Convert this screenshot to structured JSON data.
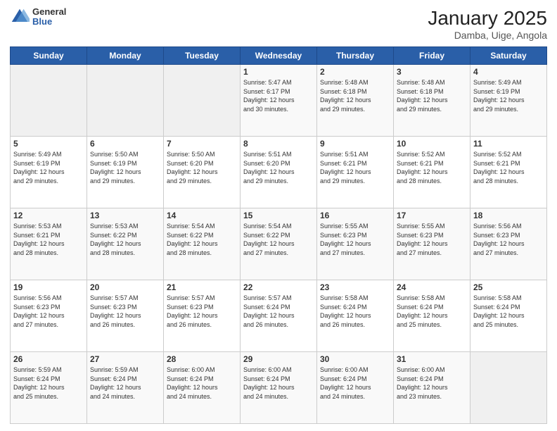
{
  "header": {
    "logo_general": "General",
    "logo_blue": "Blue",
    "title": "January 2025",
    "subtitle": "Damba, Uige, Angola"
  },
  "days_of_week": [
    "Sunday",
    "Monday",
    "Tuesday",
    "Wednesday",
    "Thursday",
    "Friday",
    "Saturday"
  ],
  "weeks": [
    [
      {
        "day": "",
        "info": ""
      },
      {
        "day": "",
        "info": ""
      },
      {
        "day": "",
        "info": ""
      },
      {
        "day": "1",
        "info": "Sunrise: 5:47 AM\nSunset: 6:17 PM\nDaylight: 12 hours\nand 30 minutes."
      },
      {
        "day": "2",
        "info": "Sunrise: 5:48 AM\nSunset: 6:18 PM\nDaylight: 12 hours\nand 29 minutes."
      },
      {
        "day": "3",
        "info": "Sunrise: 5:48 AM\nSunset: 6:18 PM\nDaylight: 12 hours\nand 29 minutes."
      },
      {
        "day": "4",
        "info": "Sunrise: 5:49 AM\nSunset: 6:19 PM\nDaylight: 12 hours\nand 29 minutes."
      }
    ],
    [
      {
        "day": "5",
        "info": "Sunrise: 5:49 AM\nSunset: 6:19 PM\nDaylight: 12 hours\nand 29 minutes."
      },
      {
        "day": "6",
        "info": "Sunrise: 5:50 AM\nSunset: 6:19 PM\nDaylight: 12 hours\nand 29 minutes."
      },
      {
        "day": "7",
        "info": "Sunrise: 5:50 AM\nSunset: 6:20 PM\nDaylight: 12 hours\nand 29 minutes."
      },
      {
        "day": "8",
        "info": "Sunrise: 5:51 AM\nSunset: 6:20 PM\nDaylight: 12 hours\nand 29 minutes."
      },
      {
        "day": "9",
        "info": "Sunrise: 5:51 AM\nSunset: 6:21 PM\nDaylight: 12 hours\nand 29 minutes."
      },
      {
        "day": "10",
        "info": "Sunrise: 5:52 AM\nSunset: 6:21 PM\nDaylight: 12 hours\nand 28 minutes."
      },
      {
        "day": "11",
        "info": "Sunrise: 5:52 AM\nSunset: 6:21 PM\nDaylight: 12 hours\nand 28 minutes."
      }
    ],
    [
      {
        "day": "12",
        "info": "Sunrise: 5:53 AM\nSunset: 6:21 PM\nDaylight: 12 hours\nand 28 minutes."
      },
      {
        "day": "13",
        "info": "Sunrise: 5:53 AM\nSunset: 6:22 PM\nDaylight: 12 hours\nand 28 minutes."
      },
      {
        "day": "14",
        "info": "Sunrise: 5:54 AM\nSunset: 6:22 PM\nDaylight: 12 hours\nand 28 minutes."
      },
      {
        "day": "15",
        "info": "Sunrise: 5:54 AM\nSunset: 6:22 PM\nDaylight: 12 hours\nand 27 minutes."
      },
      {
        "day": "16",
        "info": "Sunrise: 5:55 AM\nSunset: 6:23 PM\nDaylight: 12 hours\nand 27 minutes."
      },
      {
        "day": "17",
        "info": "Sunrise: 5:55 AM\nSunset: 6:23 PM\nDaylight: 12 hours\nand 27 minutes."
      },
      {
        "day": "18",
        "info": "Sunrise: 5:56 AM\nSunset: 6:23 PM\nDaylight: 12 hours\nand 27 minutes."
      }
    ],
    [
      {
        "day": "19",
        "info": "Sunrise: 5:56 AM\nSunset: 6:23 PM\nDaylight: 12 hours\nand 27 minutes."
      },
      {
        "day": "20",
        "info": "Sunrise: 5:57 AM\nSunset: 6:23 PM\nDaylight: 12 hours\nand 26 minutes."
      },
      {
        "day": "21",
        "info": "Sunrise: 5:57 AM\nSunset: 6:23 PM\nDaylight: 12 hours\nand 26 minutes."
      },
      {
        "day": "22",
        "info": "Sunrise: 5:57 AM\nSunset: 6:24 PM\nDaylight: 12 hours\nand 26 minutes."
      },
      {
        "day": "23",
        "info": "Sunrise: 5:58 AM\nSunset: 6:24 PM\nDaylight: 12 hours\nand 26 minutes."
      },
      {
        "day": "24",
        "info": "Sunrise: 5:58 AM\nSunset: 6:24 PM\nDaylight: 12 hours\nand 25 minutes."
      },
      {
        "day": "25",
        "info": "Sunrise: 5:58 AM\nSunset: 6:24 PM\nDaylight: 12 hours\nand 25 minutes."
      }
    ],
    [
      {
        "day": "26",
        "info": "Sunrise: 5:59 AM\nSunset: 6:24 PM\nDaylight: 12 hours\nand 25 minutes."
      },
      {
        "day": "27",
        "info": "Sunrise: 5:59 AM\nSunset: 6:24 PM\nDaylight: 12 hours\nand 24 minutes."
      },
      {
        "day": "28",
        "info": "Sunrise: 6:00 AM\nSunset: 6:24 PM\nDaylight: 12 hours\nand 24 minutes."
      },
      {
        "day": "29",
        "info": "Sunrise: 6:00 AM\nSunset: 6:24 PM\nDaylight: 12 hours\nand 24 minutes."
      },
      {
        "day": "30",
        "info": "Sunrise: 6:00 AM\nSunset: 6:24 PM\nDaylight: 12 hours\nand 24 minutes."
      },
      {
        "day": "31",
        "info": "Sunrise: 6:00 AM\nSunset: 6:24 PM\nDaylight: 12 hours\nand 23 minutes."
      },
      {
        "day": "",
        "info": ""
      }
    ]
  ]
}
